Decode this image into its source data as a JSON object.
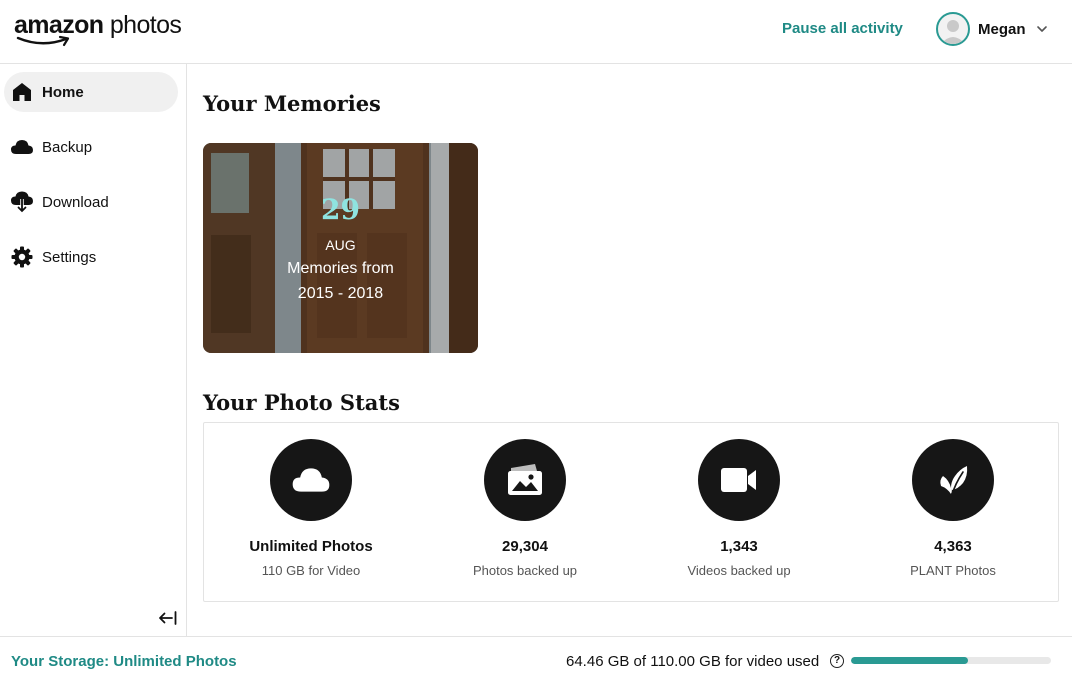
{
  "header": {
    "logo_left": "amazon",
    "logo_right": "photos",
    "pause_label": "Pause all activity",
    "user_name": "Megan",
    "user_icons": [
      "avatar-icon",
      "chevron-down-icon"
    ]
  },
  "sidebar": {
    "items": [
      {
        "label": "Home",
        "icon": "home-icon",
        "active": true
      },
      {
        "label": "Backup",
        "icon": "cloud-icon",
        "active": false
      },
      {
        "label": "Download",
        "icon": "cloud-download-icon",
        "active": false
      },
      {
        "label": "Settings",
        "icon": "gear-icon",
        "active": false
      }
    ],
    "collapse_icon": "collapse-left-icon"
  },
  "memories": {
    "title": "Your Memories",
    "card": {
      "day": "29",
      "month": "AUG",
      "line1": "Memories from",
      "line2": "2015 - 2018"
    }
  },
  "stats": {
    "title": "Your Photo Stats",
    "items": [
      {
        "icon": "cloud-icon",
        "value": "Unlimited Photos",
        "label": "110 GB for Video"
      },
      {
        "icon": "photo-icon",
        "value": "29,304",
        "label": "Photos backed up"
      },
      {
        "icon": "video-camera-icon",
        "value": "1,343",
        "label": "Videos backed up"
      },
      {
        "icon": "leaf-icon",
        "value": "4,363",
        "label": "PLANT Photos"
      }
    ]
  },
  "footer": {
    "storage_label": "Your Storage: Unlimited Photos",
    "usage_text": "64.46 GB of 110.00 GB for video used",
    "help_glyph": "?",
    "usage_fraction": 0.586
  },
  "colors": {
    "accent": "#1f8a85",
    "progress": "#2a9a93",
    "memory_day": "#8fe3e0",
    "icon_circle": "#161616"
  }
}
